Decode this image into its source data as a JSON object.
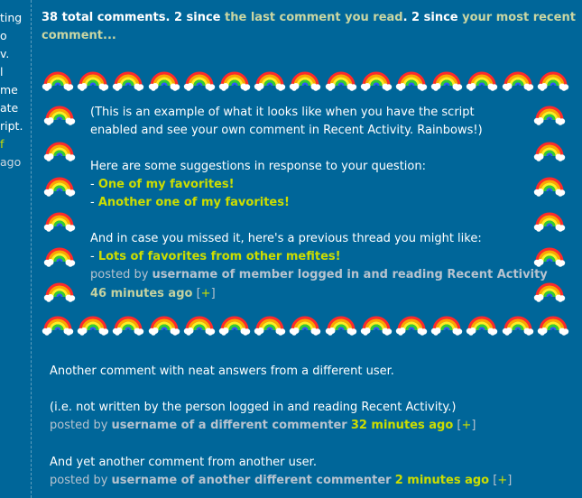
{
  "left_fragments": [
    "ting",
    "o",
    "v.",
    "l",
    "me",
    "ate",
    "ript.",
    "f",
    "ago"
  ],
  "header": {
    "count_text": "38 total comments. 2 since ",
    "last_read_link": "the last comment you read",
    "middle_text": ". 2 since ",
    "recent_link": "your most recent comment...",
    "end_text": ""
  },
  "rainbow_icon": "rainbow-with-clouds",
  "highlight_comment": {
    "line1": "(This is an example of what it looks like when you have the script",
    "line2": "enabled and see your own comment in Recent Activity. Rainbows!)",
    "suggestions_intro": "Here are some suggestions in response to your question:",
    "bullet": "-",
    "links": [
      "One of my favorites!",
      "Another one of my favorites!"
    ],
    "missed_intro": "And in case you missed it, here's a previous thread you might like:",
    "thread_link": "Lots of favorites from other mefites!",
    "posted_by": "posted by",
    "username": "username of member logged in and reading Recent Activity",
    "time": "46 minutes ago",
    "plus_open": "[",
    "plus": "+",
    "plus_close": "]"
  },
  "comments": [
    {
      "text1": "Another comment with neat answers from a different user.",
      "text2": "(i.e. not written by the person logged in and reading Recent Activity.)",
      "posted_by": "posted by",
      "username": "username of a different commenter",
      "time": "32 minutes ago",
      "plus": "+"
    },
    {
      "text1": "And yet another comment from another user.",
      "posted_by": "posted by",
      "username": "username of another different commenter",
      "time": "2 minutes ago",
      "plus": "+"
    }
  ],
  "colors": {
    "background": "#006699",
    "link_yellow": "#ccdd00",
    "muted": "#b7c3cf",
    "header_link": "#c9d6a3"
  }
}
